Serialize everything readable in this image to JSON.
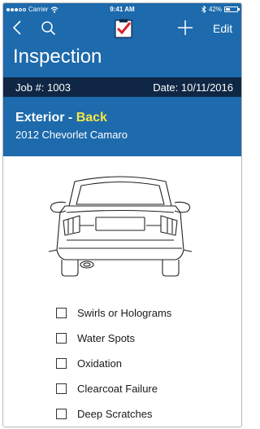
{
  "status_bar": {
    "carrier": "Carrier",
    "time": "9:41 AM",
    "battery": "42%",
    "battery_level": 0.42,
    "signal_bars_filled": 3,
    "signal_bars_total": 5
  },
  "nav": {
    "back_icon": "chevron-left-icon",
    "search_icon": "search-icon",
    "logo_icon": "clipboard-check-logo-icon",
    "add_icon": "plus-icon",
    "edit_label": "Edit"
  },
  "page": {
    "title": "Inspection"
  },
  "job": {
    "job_label": "Job #: 1003",
    "date_label": "Date: 10/11/2016"
  },
  "section": {
    "title_prefix": "Exterior - ",
    "title_highlight": "Back",
    "vehicle": "2012 Chevorlet Camaro"
  },
  "checklist": {
    "items": [
      {
        "label": "Swirls or Holograms",
        "checked": false
      },
      {
        "label": "Water Spots",
        "checked": false
      },
      {
        "label": "Oxidation",
        "checked": false
      },
      {
        "label": "Clearcoat Failure",
        "checked": false
      },
      {
        "label": "Deep Scratches",
        "checked": false
      }
    ]
  },
  "colors": {
    "primary_blue": "#1d6aac",
    "dark_navy": "#0f2744",
    "highlight_yellow": "#f5e642",
    "logo_red": "#d4242b"
  }
}
